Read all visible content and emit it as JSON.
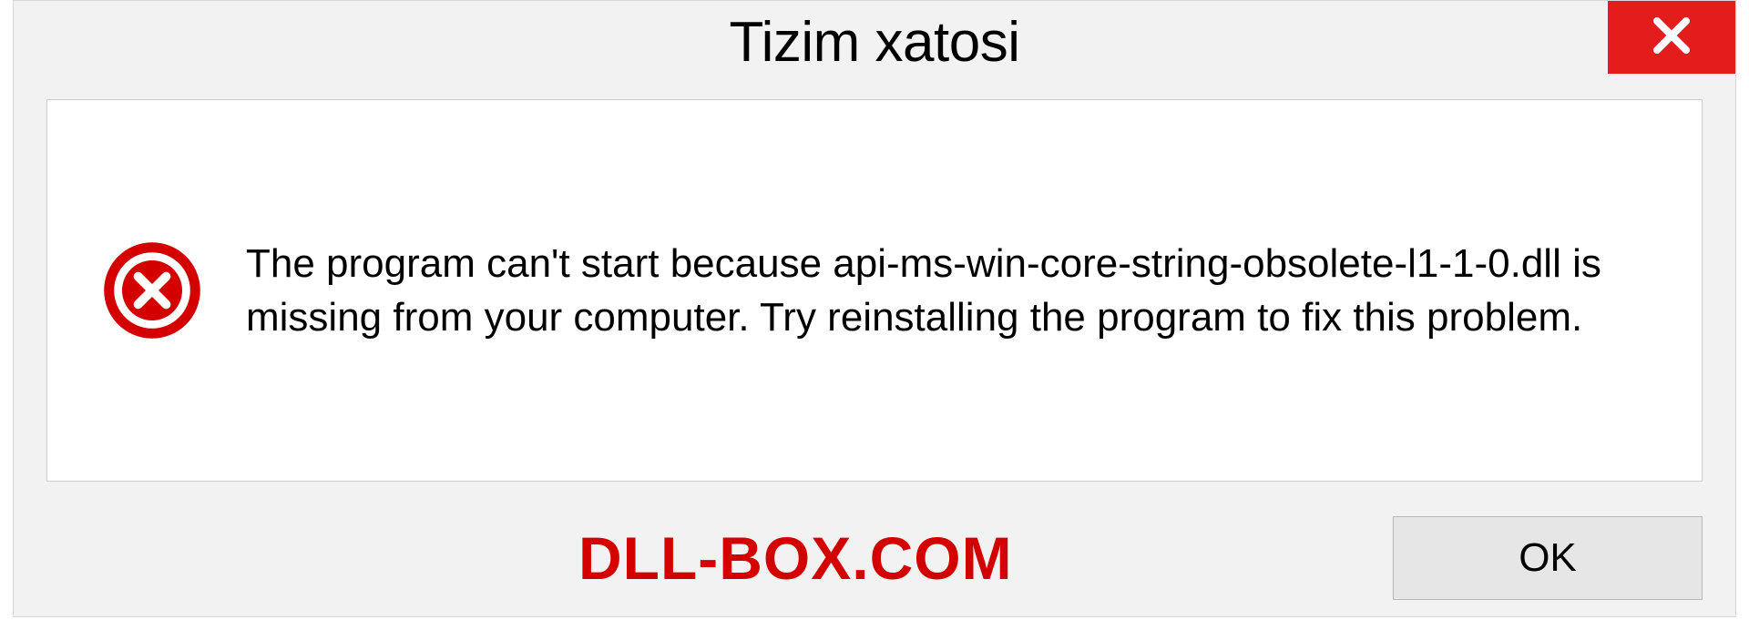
{
  "dialog": {
    "title": "Tizim xatosi",
    "message": "The program can't start because api-ms-win-core-string-obsolete-l1-1-0.dll is missing from your computer. Try reinstalling the program to fix this problem.",
    "ok_label": "OK"
  },
  "watermark": "DLL-BOX.COM"
}
